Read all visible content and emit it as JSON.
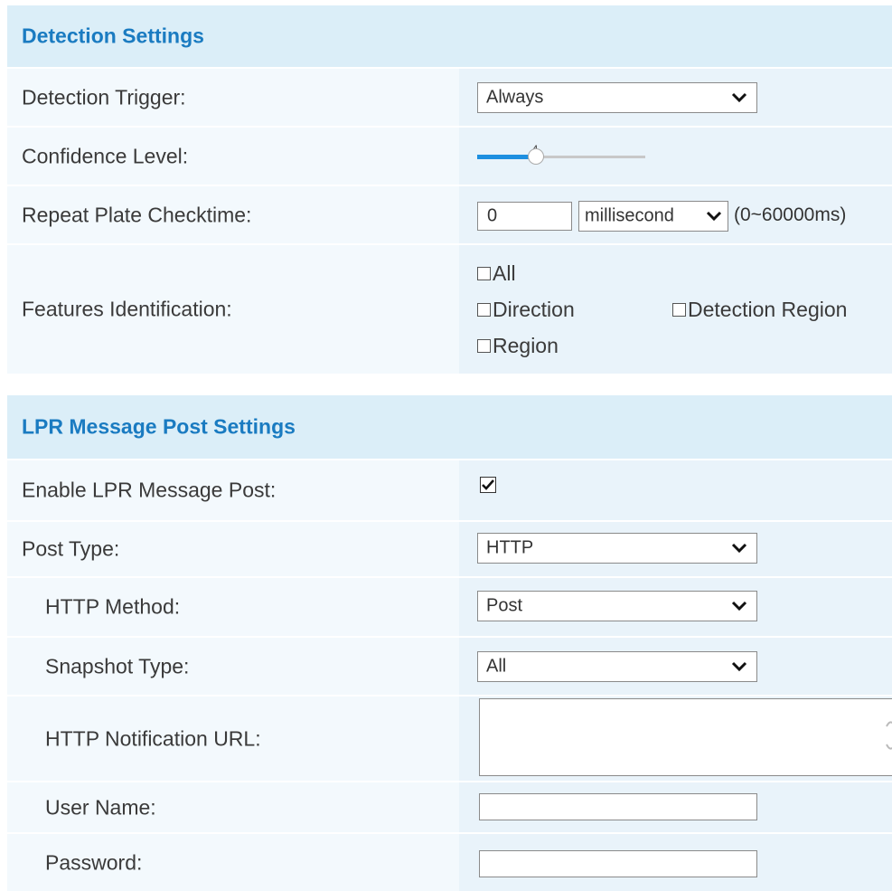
{
  "detection": {
    "title": "Detection Settings",
    "trigger_label": "Detection Trigger:",
    "trigger_value": "Always",
    "confidence_label": "Confidence Level:",
    "confidence_value": "4",
    "confidence_fraction": 0.35,
    "repeat_label": "Repeat Plate Checktime:",
    "repeat_value": "0",
    "repeat_unit": "millisecond",
    "repeat_range": "(0~60000ms)",
    "features_label": "Features Identification:",
    "features": [
      {
        "label": "All",
        "checked": false
      },
      {
        "label": "Direction",
        "checked": false
      },
      {
        "label": "Detection Region",
        "checked": false
      },
      {
        "label": "Region",
        "checked": false
      }
    ]
  },
  "lpr": {
    "title": "LPR Message Post Settings",
    "enable_label": "Enable LPR Message Post:",
    "enable_checked": true,
    "post_type_label": "Post Type:",
    "post_type_value": "HTTP",
    "http_method_label": "HTTP Method:",
    "http_method_value": "Post",
    "snapshot_label": "Snapshot Type:",
    "snapshot_value": "All",
    "url_label": "HTTP Notification URL:",
    "url_value": "",
    "username_label": "User Name:",
    "username_value": "",
    "password_label": "Password:",
    "password_value": ""
  },
  "colors": {
    "header_bg": "#dbeef8",
    "header_text": "#1a7bc1",
    "row_bg": "#f3f9fd",
    "slider_fill": "#1d8fe0"
  }
}
